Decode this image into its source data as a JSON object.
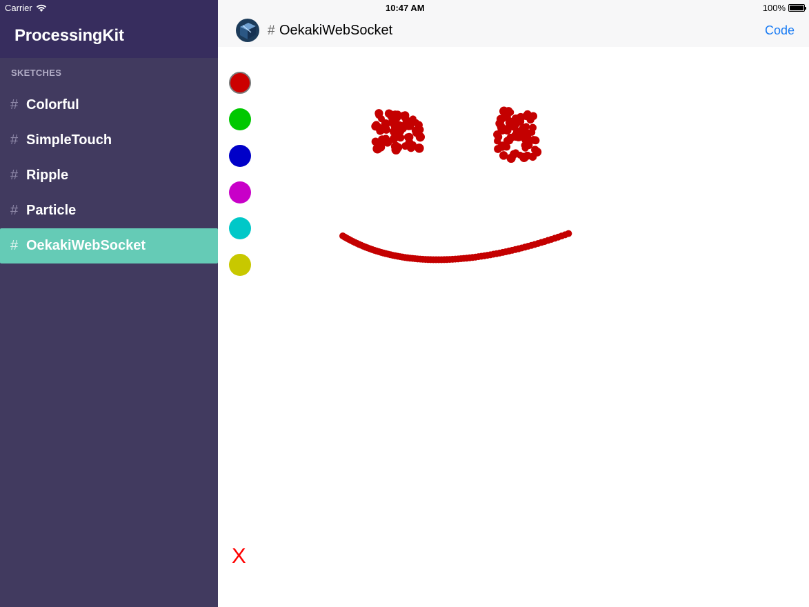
{
  "status_bar": {
    "carrier": "Carrier",
    "time": "10:47 AM",
    "battery": "100%",
    "wifi_icon": "wifi-icon",
    "battery_icon": "battery-icon"
  },
  "sidebar": {
    "title": "ProcessingKit",
    "section_label": "SKETCHES",
    "items": [
      {
        "hash": "#",
        "label": "Colorful",
        "active": false
      },
      {
        "hash": "#",
        "label": "SimpleTouch",
        "active": false
      },
      {
        "hash": "#",
        "label": "Ripple",
        "active": false
      },
      {
        "hash": "#",
        "label": "Particle",
        "active": false
      },
      {
        "hash": "#",
        "label": "OekakiWebSocket",
        "active": true
      }
    ],
    "colors": {
      "background": "#413a5f",
      "header": "#372d5e",
      "active": "#65cbb6"
    }
  },
  "navbar": {
    "hash": "#",
    "title": "OekakiWebSocket",
    "code_label": "Code",
    "logo_icon": "processingkit-logo-icon",
    "accent_color": "#1a7cf4"
  },
  "canvas": {
    "palette": [
      {
        "name": "red",
        "color": "#cc0000",
        "selected": true
      },
      {
        "name": "green",
        "color": "#00c800",
        "selected": false
      },
      {
        "name": "blue",
        "color": "#0000c8",
        "selected": false
      },
      {
        "name": "magenta",
        "color": "#c800c8",
        "selected": false
      },
      {
        "name": "cyan",
        "color": "#00c8c8",
        "selected": false
      },
      {
        "name": "yellow",
        "color": "#c8c800",
        "selected": false
      }
    ],
    "clear_label": "X",
    "stroke_color": "#c40000"
  }
}
